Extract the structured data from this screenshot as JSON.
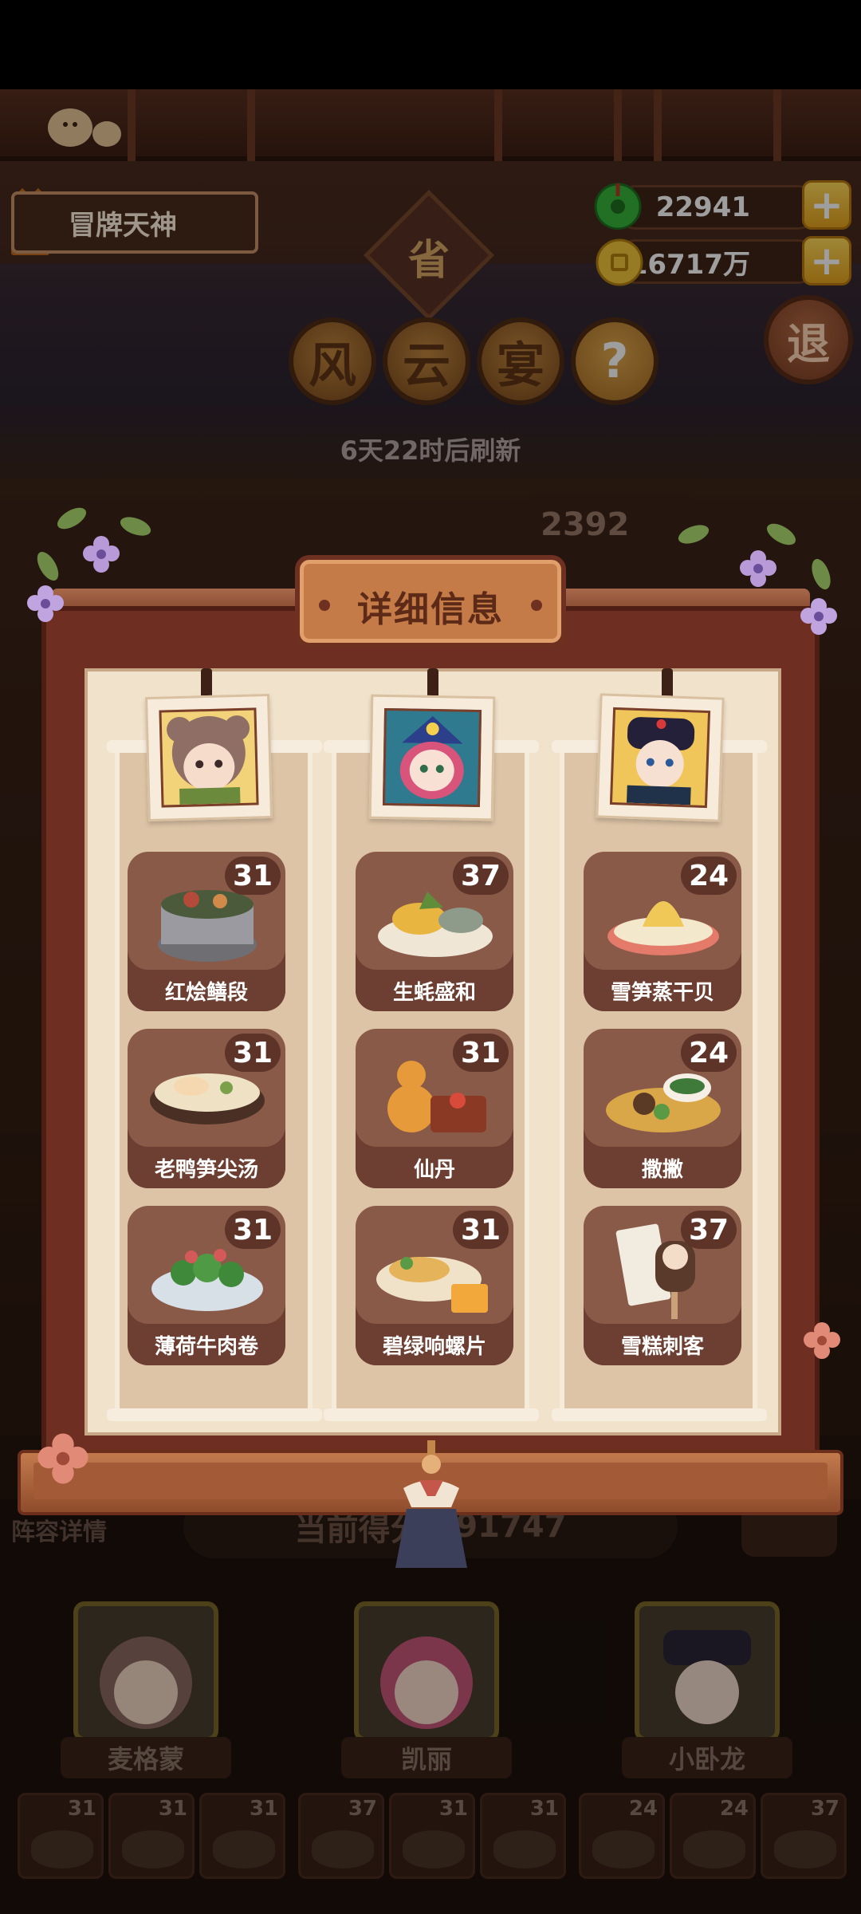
{
  "player": {
    "title": "冒牌天神"
  },
  "resources": {
    "jade": {
      "value": "22941",
      "icon": "jade-gem-icon"
    },
    "coins": {
      "value": "16717万",
      "icon": "coin-icon"
    }
  },
  "event": {
    "province_badge": "省",
    "title_chars": [
      "风",
      "云",
      "宴"
    ],
    "help_label": "?",
    "exit_label": "退",
    "refresh_text": "6天22时后刷新",
    "score_peek": "2392"
  },
  "modal": {
    "title": "详细信息",
    "columns": [
      {
        "hero": "麦格蒙",
        "dishes": [
          {
            "name": "红烩鳝段",
            "count": "31"
          },
          {
            "name": "老鸭笋尖汤",
            "count": "31"
          },
          {
            "name": "薄荷牛肉卷",
            "count": "31"
          }
        ]
      },
      {
        "hero": "凯丽",
        "dishes": [
          {
            "name": "生蚝盛和",
            "count": "37"
          },
          {
            "name": "仙丹",
            "count": "31"
          },
          {
            "name": "碧绿响螺片",
            "count": "31"
          }
        ]
      },
      {
        "hero": "小卧龙",
        "dishes": [
          {
            "name": "雪笋蒸干贝",
            "count": "24"
          },
          {
            "name": "撒撇",
            "count": "24"
          },
          {
            "name": "雪糕刺客",
            "count": "37"
          }
        ]
      }
    ]
  },
  "team": {
    "label": "阵容详情",
    "score_label": "当前得分",
    "score_value": "291747",
    "heroes": [
      "麦格蒙",
      "凯丽",
      "小卧龙"
    ],
    "dish_counts": [
      "31",
      "31",
      "31",
      "37",
      "31",
      "31",
      "24",
      "24",
      "37"
    ]
  },
  "colors": {
    "modal_frame": "#6e2e21",
    "parchment": "#f1e2cc",
    "dish_card": "#8a5a49",
    "gold_button": "#ffd95a"
  }
}
